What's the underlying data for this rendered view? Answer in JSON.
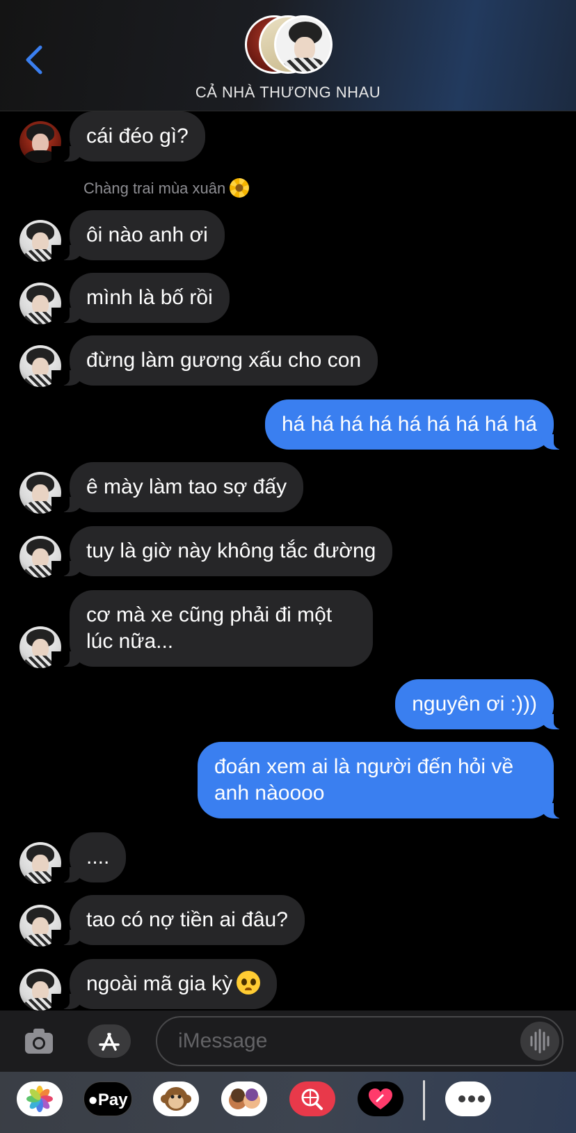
{
  "header": {
    "title": "CẢ NHÀ THƯƠNG NHAU",
    "back_icon": "chevron-left-icon",
    "accent": "#3a7ff0"
  },
  "messages": [
    {
      "side": "in",
      "text": "cái đéo gì?"
    },
    {
      "sender": "Chàng trai mùa xuân"
    },
    {
      "side": "in",
      "text": "ôi nào anh ơi"
    },
    {
      "side": "in",
      "text": "mình là bố rồi"
    },
    {
      "side": "in",
      "text": "đừng làm gương xấu cho con"
    },
    {
      "side": "out",
      "text": "há há há há há há há há há"
    },
    {
      "side": "in",
      "text": "ê mày làm tao sợ đấy"
    },
    {
      "side": "in",
      "text": "tuy là giờ này không tắc đường"
    },
    {
      "side": "in",
      "text": "cơ mà xe cũng phải đi một lúc nữa..."
    },
    {
      "side": "out",
      "text": "nguyên ơi :)))"
    },
    {
      "side": "out",
      "text": "đoán xem ai là người đến hỏi về anh nàoooo"
    },
    {
      "side": "in",
      "text": "...."
    },
    {
      "side": "in",
      "text": "tao có nợ tiền ai đâu?"
    },
    {
      "side": "in",
      "text": "ngoài mã gia kỳ"
    }
  ],
  "composer": {
    "placeholder": "iMessage"
  },
  "app_drawer": {
    "apple_pay_label": "Pay",
    "apps": [
      "photos-icon",
      "apple-pay-icon",
      "monkey-emoji-icon",
      "memoji-icon",
      "web-search-icon",
      "digital-touch-icon",
      "more-icon"
    ]
  },
  "colors": {
    "incoming_bubble": "#262628",
    "outgoing_bubble": "#3a7ff0",
    "background": "#000000"
  }
}
